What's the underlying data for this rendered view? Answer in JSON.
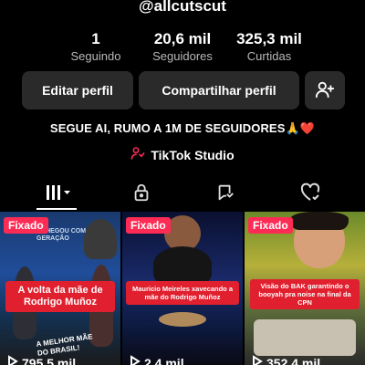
{
  "profile": {
    "username": "@allcutscut"
  },
  "stats": [
    {
      "value": "1",
      "label": "Seguindo"
    },
    {
      "value": "20,6 mil",
      "label": "Seguidores"
    },
    {
      "value": "325,3 mil",
      "label": "Curtidas"
    }
  ],
  "actions": {
    "edit_label": "Editar perfil",
    "share_label": "Compartilhar perfil",
    "add_friend_icon": "add-friend-icon"
  },
  "bio": {
    "text": "SEGUE AI, RUMO A 1M DE SEGUIDORES",
    "emoji": "🙏❤️"
  },
  "studio": {
    "label": "TikTok Studio",
    "icon": "tiktok-studio-icon"
  },
  "tabs": [
    {
      "icon": "grid-icon",
      "active": true
    },
    {
      "icon": "lock-icon",
      "active": false
    },
    {
      "icon": "repost-icon",
      "active": false
    },
    {
      "icon": "liked-icon",
      "active": false
    }
  ],
  "videos": [
    {
      "pinned_label": "Fixado",
      "caption": "A volta da mãe de Rodrigo Muñoz",
      "views": "795,5 mil",
      "thumb_text_top": "ACHEGOU COM GERAÇÃO",
      "thumb_text_bottom": "A MELHOR MÃE DO BRASIL!"
    },
    {
      "pinned_label": "Fixado",
      "caption": "Mauricio Meireles xavecando a mãe do Rodrigo Muñoz",
      "views": "2,4 mil"
    },
    {
      "pinned_label": "Fixado",
      "caption": "Visão do BAK garantindo o booyah pra noise na final da CPN",
      "views": "352,4 mil"
    }
  ],
  "colors": {
    "background": "#000000",
    "button_bg": "#2a2a2a",
    "pin_badge": "#fe2c55",
    "caption_bg": "#e0202e",
    "muted_text": "#b9b9b9"
  }
}
